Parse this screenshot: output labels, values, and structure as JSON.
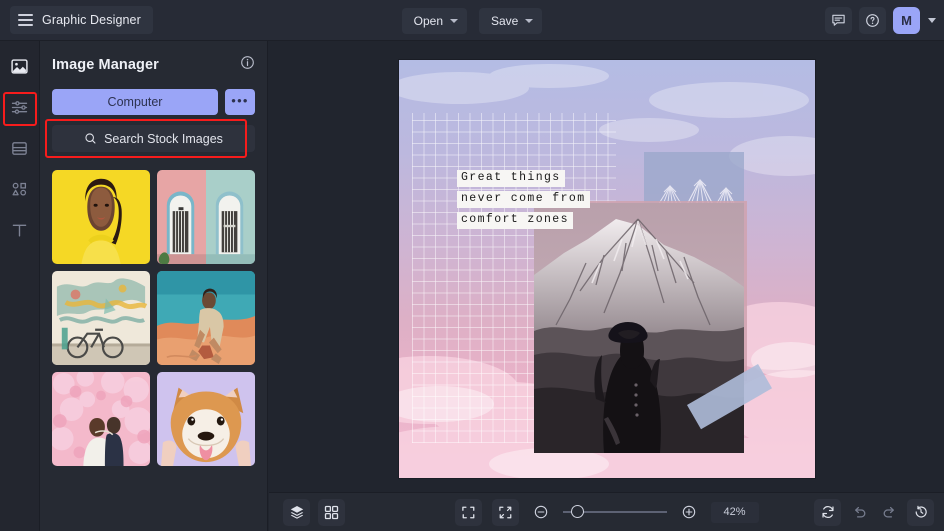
{
  "topbar": {
    "menu_icon": "hamburger-icon",
    "brand": "Graphic Designer",
    "open_label": "Open",
    "save_label": "Save",
    "comment_icon": "comment-icon",
    "help_icon": "help-circle-icon",
    "avatar_initial": "M",
    "avatar_caret_icon": "chevron-down-icon"
  },
  "rail": {
    "items": [
      {
        "name": "image-manager",
        "icon": "image-icon",
        "selected": true
      },
      {
        "name": "adjustments",
        "icon": "sliders-icon",
        "selected": false
      },
      {
        "name": "layouts",
        "icon": "layout-rows-icon",
        "selected": false
      },
      {
        "name": "shapes",
        "icon": "shapes-icon",
        "selected": false
      },
      {
        "name": "text",
        "icon": "text-t-icon",
        "selected": false
      }
    ],
    "highlight_color": "#f71c1c"
  },
  "panel": {
    "title": "Image Manager",
    "info_icon": "info-circle-icon",
    "computer_label": "Computer",
    "more_label": "•••",
    "search_placeholder": "Search Stock Images",
    "search_icon": "search-icon",
    "search_highlight_color": "#f71c1c",
    "accent_color": "#9aa5f7",
    "thumbnails": [
      {
        "name": "thumb-portrait-yellow",
        "alt": "Woman in yellow shirt on yellow background"
      },
      {
        "name": "thumb-doors",
        "alt": "Two doors on pink and mint walls"
      },
      {
        "name": "thumb-bicycle-mural",
        "alt": "Bicycle in front of painted mural"
      },
      {
        "name": "thumb-desert-man",
        "alt": "Man sitting on desert sand dune"
      },
      {
        "name": "thumb-wedding-blossom",
        "alt": "Couple among pink cherry blossoms"
      },
      {
        "name": "thumb-shiba-dog",
        "alt": "Shiba Inu dog on lilac background"
      }
    ]
  },
  "canvas": {
    "quote_lines": [
      "Great things",
      "never come from",
      "comfort zones"
    ],
    "photo_alt": "Black and white mountain with silhouetted person",
    "sketch_alt": "Line-art mountain range sketch"
  },
  "bottombar": {
    "layers_icon": "layers-icon",
    "grid_icon": "grid-view-icon",
    "fit_icon": "fit-to-screen-icon",
    "shrink_icon": "collapse-arrows-icon",
    "zoom_out_icon": "zoom-out-icon",
    "zoom_in_icon": "zoom-in-icon",
    "zoom_value": "42%",
    "refresh_icon": "refresh-icon",
    "undo_icon": "undo-icon",
    "redo_icon": "redo-icon",
    "history_icon": "history-clock-icon"
  }
}
